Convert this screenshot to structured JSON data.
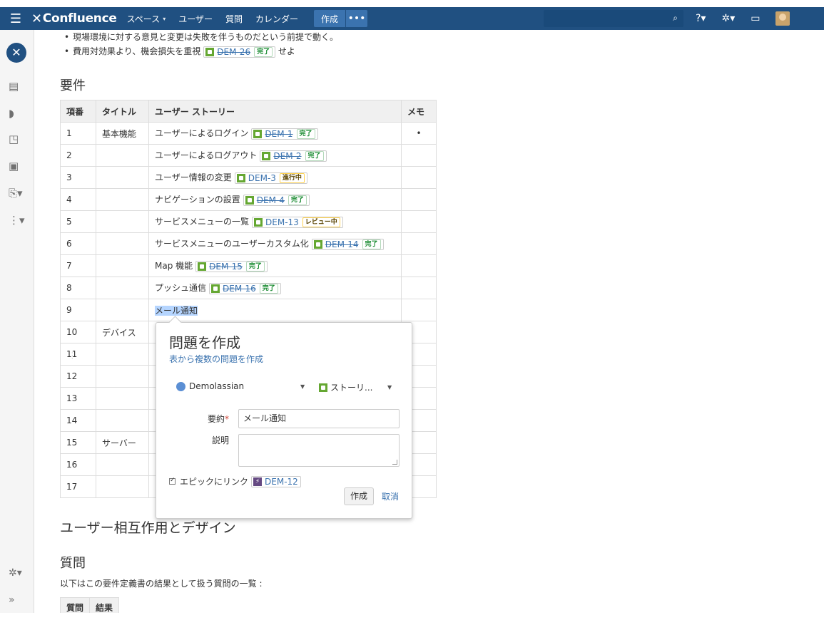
{
  "nav": {
    "logo": "Confluence",
    "items": [
      "スペース",
      "ユーザー",
      "質問",
      "カレンダー"
    ],
    "create": "作成",
    "more": "•••"
  },
  "bullets": [
    "現場環境に対する意見と変更は失敗を伴うものだという前提で動く。",
    "費用対効果より、機会損失を重視"
  ],
  "bullet2_issue": {
    "key": "DEM-26",
    "status": "完了"
  },
  "bullet2_suffix": "せよ",
  "section_requirements": "要件",
  "table": {
    "headers": [
      "項番",
      "タイトル",
      "ユーザー ストーリー",
      "メモ"
    ],
    "rows": [
      {
        "num": "1",
        "title": "基本機能",
        "story": "ユーザーによるログイン",
        "key": "DEM-1",
        "status": "完了",
        "memo": "•"
      },
      {
        "num": "2",
        "title": "",
        "story": "ユーザーによるログアウト",
        "key": "DEM-2",
        "status": "完了",
        "memo": ""
      },
      {
        "num": "3",
        "title": "",
        "story": "ユーザー情報の変更",
        "key": "DEM-3",
        "status": "進行中",
        "memo": ""
      },
      {
        "num": "4",
        "title": "",
        "story": "ナビゲーションの設置",
        "key": "DEM-4",
        "status": "完了",
        "memo": ""
      },
      {
        "num": "5",
        "title": "",
        "story": "サービスメニューの一覧",
        "key": "DEM-13",
        "status": "レビュー中",
        "memo": ""
      },
      {
        "num": "6",
        "title": "",
        "story": "サービスメニューのユーザーカスタム化",
        "key": "DEM-14",
        "status": "完了",
        "memo": ""
      },
      {
        "num": "7",
        "title": "",
        "story": "Map 機能",
        "key": "DEM-15",
        "status": "完了",
        "memo": ""
      },
      {
        "num": "8",
        "title": "",
        "story": "プッシュ通信",
        "key": "DEM-16",
        "status": "完了",
        "memo": ""
      },
      {
        "num": "9",
        "title": "",
        "story": "メール通知",
        "key": "",
        "status": "",
        "memo": ""
      },
      {
        "num": "10",
        "title": "デバイス",
        "story": "",
        "key": "",
        "status": "",
        "memo": ""
      },
      {
        "num": "11",
        "title": "",
        "story": "",
        "key": "",
        "status": "",
        "memo": ""
      },
      {
        "num": "12",
        "title": "",
        "story": "",
        "key": "",
        "status": "",
        "memo": ""
      },
      {
        "num": "13",
        "title": "",
        "story": "",
        "key": "",
        "status": "",
        "memo": ""
      },
      {
        "num": "14",
        "title": "",
        "story": "",
        "key": "",
        "status": "",
        "memo": ""
      },
      {
        "num": "15",
        "title": "サーバー",
        "story": "",
        "key": "",
        "status": "",
        "memo": ""
      },
      {
        "num": "16",
        "title": "",
        "story": "",
        "key": "",
        "status": "",
        "memo": ""
      },
      {
        "num": "17",
        "title": "",
        "story": "",
        "key": "",
        "status": "",
        "memo": ""
      }
    ]
  },
  "dialog": {
    "title": "問題を作成",
    "multi_link": "表から複数の問題を作成",
    "project": "Demolassian",
    "issue_type": "ストーリ...",
    "summary_label": "要約",
    "summary_value": "メール通知",
    "desc_label": "説明",
    "epic_label": "エピックにリンク",
    "epic_key": "DEM-12",
    "create_btn": "作成",
    "cancel_btn": "取消"
  },
  "section_ux": "ユーザー相互作用とデザイン",
  "section_questions": "質問",
  "questions_intro": "以下はこの要件定義書の結果として扱う質問の一覧 :",
  "q_table_headers": [
    "質問",
    "結果"
  ],
  "colors": {
    "nav": "#205081",
    "link": "#3b73af",
    "done": "#14892c",
    "progress": "#ffd351"
  }
}
